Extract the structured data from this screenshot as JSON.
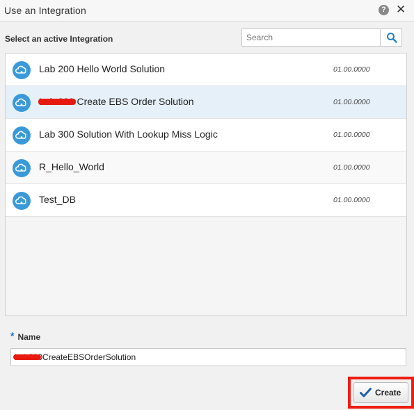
{
  "dialog": {
    "title": "Use an Integration",
    "help_glyph": "?",
    "close_glyph": "✕",
    "section_label": "Select an active Integration"
  },
  "search": {
    "placeholder": "Search",
    "value": "",
    "icon": "search-icon"
  },
  "integrations": [
    {
      "name": "Lab 200 Hello World Solution",
      "version": "01.00.0000",
      "icon": "cloud-integration-icon",
      "selected": false
    },
    {
      "name": "Lab 300 Create EBS Order Solution",
      "version": "01.00.0000",
      "icon": "cloud-integration-icon",
      "selected": true
    },
    {
      "name": "Lab 300 Solution With Lookup Miss Logic",
      "version": "01.00.0000",
      "icon": "cloud-integration-icon",
      "selected": false
    },
    {
      "name": "R_Hello_World",
      "version": "01.00.0000",
      "icon": "cloud-integration-icon",
      "selected": false
    },
    {
      "name": "Test_DB",
      "version": "01.00.0000",
      "icon": "cloud-integration-icon",
      "selected": false
    }
  ],
  "name_field": {
    "required_marker": "*",
    "label": "Name",
    "value": "Lab300CreateEBSOrderSolution"
  },
  "actions": {
    "create_label": "Create",
    "create_icon": "checkmark-icon"
  },
  "colors": {
    "accent": "#3a9ad9",
    "selected_row": "#e6f0f8",
    "highlight": "#ee1d12",
    "checkmark": "#1d5fa8"
  }
}
